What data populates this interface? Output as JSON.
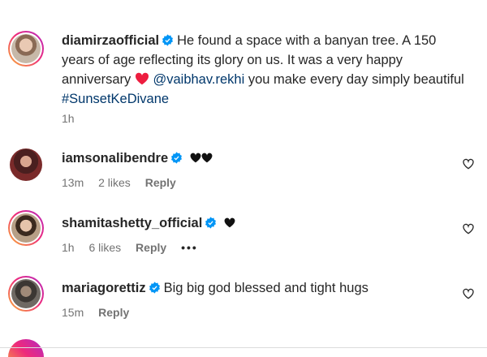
{
  "caption": {
    "username": "diamirzaofficial",
    "text_1": "He found a space with a banyan tree. A 150 years of age reflecting its glory on us. It was a very happy anniversary",
    "mention": "@vaibhav.rekhi",
    "text_2": "you make every day simply beautiful",
    "hashtag": "#SunsetKeDivane",
    "time": "1h"
  },
  "comments": [
    {
      "username": "iamsonalibendre",
      "text": "",
      "time": "13m",
      "likes": "2 likes",
      "reply": "Reply"
    },
    {
      "username": "shamitashetty_official",
      "text": "",
      "time": "1h",
      "likes": "6 likes",
      "reply": "Reply",
      "more": "•••"
    },
    {
      "username": "mariagorettiz",
      "text": "Big big god blessed and tight hugs",
      "time": "15m",
      "reply": "Reply"
    }
  ],
  "colors": {
    "accent_link": "#00376b",
    "verified_blue": "#0095f6",
    "heart_red": "#ed1d3f",
    "muted": "#737373"
  },
  "icons": [
    "verified-badge-icon",
    "red-heart-emoji-icon",
    "black-heart-emoji-icon",
    "like-heart-outline-icon",
    "more-options-icon"
  ]
}
